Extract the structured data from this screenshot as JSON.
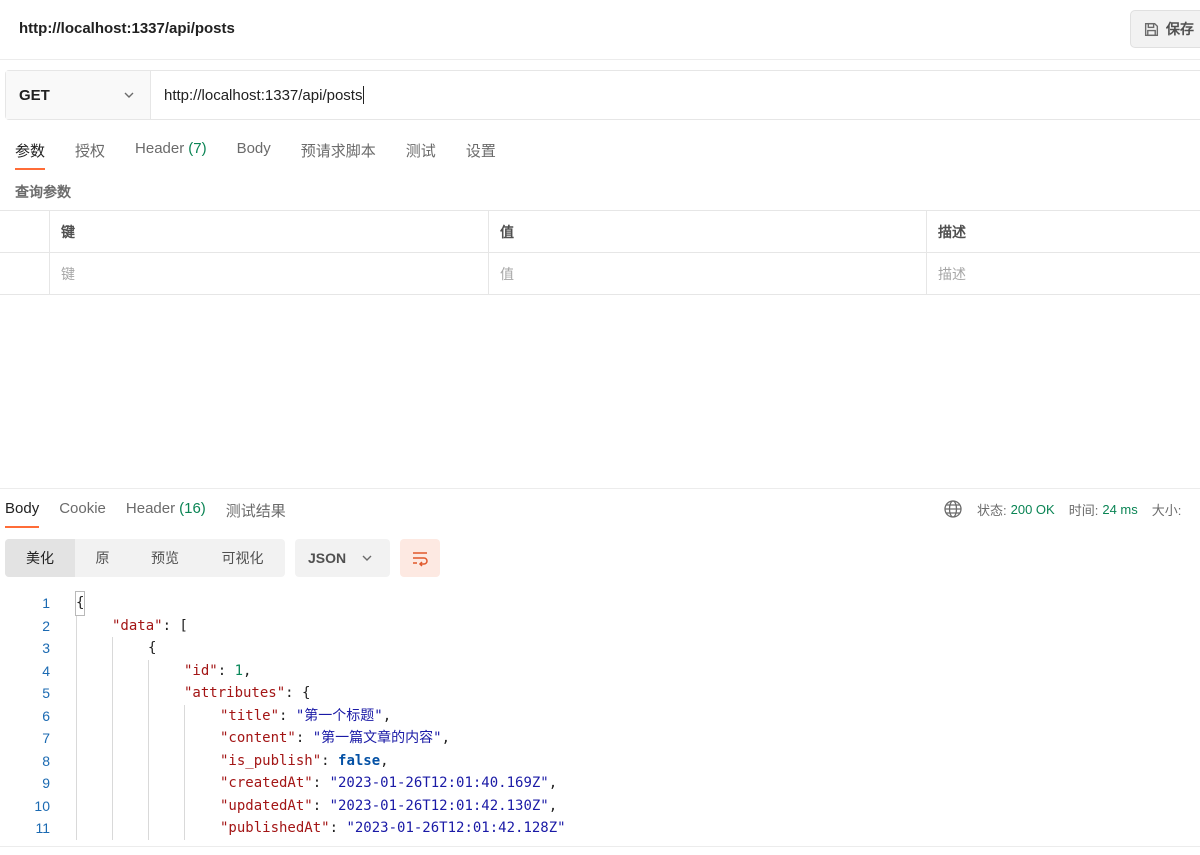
{
  "header": {
    "title": "http://localhost:1337/api/posts",
    "save_label": "保存"
  },
  "request": {
    "method": "GET",
    "url": "http://localhost:1337/api/posts",
    "tabs": [
      {
        "label": "参数",
        "count": "",
        "active": true
      },
      {
        "label": "授权",
        "count": ""
      },
      {
        "label": "Header",
        "count": "(7)"
      },
      {
        "label": "Body",
        "count": ""
      },
      {
        "label": "预请求脚本",
        "count": ""
      },
      {
        "label": "测试",
        "count": ""
      },
      {
        "label": "设置",
        "count": ""
      }
    ],
    "section_label": "查询参数",
    "table": {
      "headers": [
        "键",
        "值",
        "描述"
      ],
      "placeholders": [
        "键",
        "值",
        "描述"
      ]
    }
  },
  "response": {
    "tabs": [
      {
        "label": "Body",
        "count": "",
        "active": true
      },
      {
        "label": "Cookie",
        "count": ""
      },
      {
        "label": "Header",
        "count": "(16)"
      },
      {
        "label": "测试结果",
        "count": ""
      }
    ],
    "status_label": "状态:",
    "status_value": "200 OK",
    "time_label": "时间:",
    "time_value": "24 ms",
    "size_label": "大小:",
    "view_modes": [
      "美化",
      "原",
      "预览",
      "可视化"
    ],
    "format": "JSON",
    "code_lines": [
      {
        "n": "1",
        "text": "{"
      },
      {
        "n": "2",
        "text": "\"data\": ["
      },
      {
        "n": "3",
        "text": "{"
      },
      {
        "n": "4",
        "text": "\"id\": 1,"
      },
      {
        "n": "5",
        "text": "\"attributes\": {"
      },
      {
        "n": "6",
        "text": "\"title\": \"第一个标题\","
      },
      {
        "n": "7",
        "text": "\"content\": \"第一篇文章的内容\","
      },
      {
        "n": "8",
        "text": "\"is_publish\": false,"
      },
      {
        "n": "9",
        "text": "\"createdAt\": \"2023-01-26T12:01:40.169Z\","
      },
      {
        "n": "10",
        "text": "\"updatedAt\": \"2023-01-26T12:01:42.130Z\","
      },
      {
        "n": "11",
        "text": "\"publishedAt\": \"2023-01-26T12:01:42.128Z\""
      }
    ]
  },
  "colors": {
    "accent": "#ff6c37",
    "success": "#0a8454",
    "line_number": "#1b6ab2"
  }
}
